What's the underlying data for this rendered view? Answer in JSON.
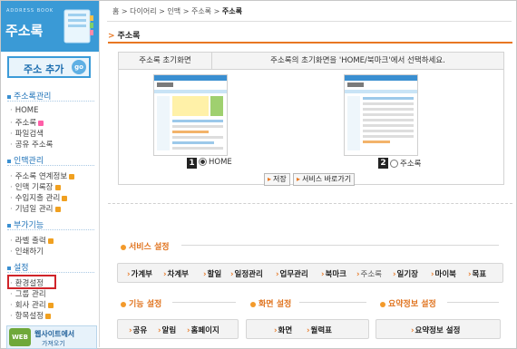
{
  "sidebar": {
    "header_small": "ADDRESS BOOK",
    "header_title": "주소록",
    "add_button": "주소 추가",
    "go_badge": "go",
    "sections": [
      {
        "title": "주소록관리",
        "items": [
          "HOME",
          "주소록",
          "파일검색",
          "공유 주소록"
        ]
      },
      {
        "title": "인맥관리",
        "items": [
          "주소록 연계정보",
          "인맥 기록장",
          "수입지출 관리",
          "기념일 관리"
        ]
      },
      {
        "title": "부가기능",
        "items": [
          "라벨 출력",
          "인쇄하기"
        ]
      },
      {
        "title": "설정",
        "items": [
          "환경설정",
          "그룹 관리",
          "회사 관리",
          "항목설정"
        ]
      }
    ],
    "banner_line1": "웹사이트에서",
    "banner_line2": "가져오기",
    "banner_logo": "WEB"
  },
  "breadcrumb": {
    "parts": [
      "홈",
      "다이어리",
      "인맥",
      "주소록"
    ],
    "current": "주소록"
  },
  "page_title": "주소록",
  "home_setting": {
    "label": "주소록 초기화면",
    "description": "주소록의 초기화면을 'HOME/북마크'에서 선택하세요.",
    "options": [
      {
        "num": "1",
        "label": "HOME",
        "selected": true
      },
      {
        "num": "2",
        "label": "주소록",
        "selected": false
      }
    ],
    "thumb_logo": "다이어리",
    "save_button": "저장",
    "shortcut_button": "서비스 바로가기"
  },
  "service_settings": {
    "title": "서비스 설정",
    "items": [
      "가계부",
      "차계부",
      "할일",
      "일정관리",
      "업무관리",
      "북마크",
      "주소록",
      "일기장",
      "마이북",
      "목표"
    ]
  },
  "function_settings": {
    "title": "기능 설정",
    "items": [
      "공유",
      "알림",
      "홈페이지"
    ]
  },
  "screen_settings": {
    "title": "화면 설정",
    "items": [
      "화면",
      "월력표"
    ]
  },
  "summary_settings": {
    "title": "요약정보 설정",
    "items": [
      "요약정보 설정"
    ]
  },
  "colors": {
    "accent": "#e87722",
    "sidebar_blue": "#3a9ad6",
    "highlight_red": "#d0242a"
  }
}
